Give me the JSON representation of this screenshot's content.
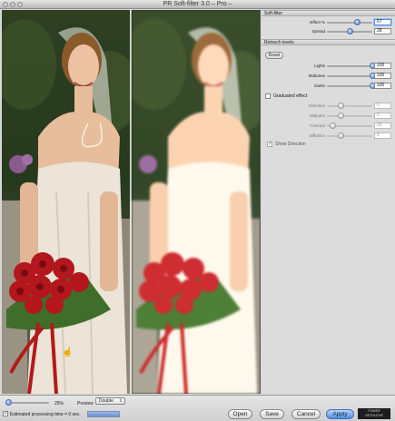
{
  "window": {
    "title": "PR Soft-filter 3.0 – Pro –"
  },
  "soft_filter": {
    "heading": "Soft-filter",
    "effect": {
      "label": "Effect %",
      "value": "67",
      "level": 0.67
    },
    "spread": {
      "label": "Spread",
      "value": "28",
      "level": 0.5
    }
  },
  "retouch": {
    "heading": "Retouch levels",
    "reset_label": "Reset",
    "lights": {
      "label": "Lights",
      "value": "100",
      "level": 1.0
    },
    "midtones": {
      "label": "Midtones",
      "value": "100",
      "level": 1.0
    },
    "darks": {
      "label": "Darks",
      "value": "100",
      "level": 1.0
    }
  },
  "graduated": {
    "label": "Graduated effect",
    "checked": false,
    "direction": {
      "label": "Direction",
      "value": "0",
      "level": 0.3
    },
    "midpoint": {
      "label": "Midpoint",
      "value": "0",
      "level": 0.3
    },
    "contrast": {
      "label": "Contrast",
      "value": "25",
      "level": 0.12
    },
    "diffusion": {
      "label": "Diffusion",
      "value": "5",
      "level": 0.3
    },
    "show_direction": {
      "label": "Show Direction",
      "checked": true
    }
  },
  "bottom": {
    "zoom": "25%",
    "preview_label": "Preview",
    "preview_mode": "Double",
    "estimate_label": "Estimated processing time = 0 sec.",
    "estimate_checked": true,
    "progress": 1.0
  },
  "actions": {
    "open": "Open",
    "save": "Save",
    "cancel": "Cancel",
    "apply": "Apply"
  },
  "logo": {
    "line1": "POWER",
    "line2": "RETOUCHE"
  },
  "colors": {
    "accent": "#4f8ee0",
    "panel": "#dcdcdc",
    "background_foliage": "#1b2a18",
    "dress": "#ece4d8",
    "roses": "#b3161c"
  }
}
